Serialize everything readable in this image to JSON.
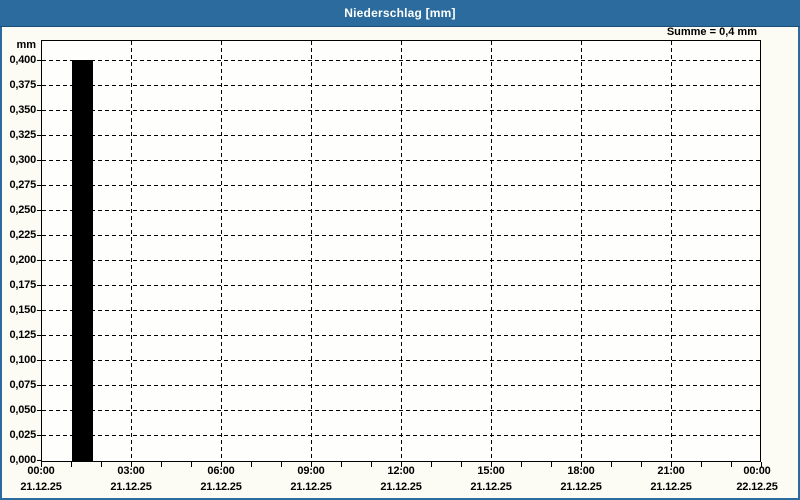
{
  "window": {
    "title": "Niederschlag [mm]",
    "title_bar_color": "#2b6b9d",
    "border_color": "#2b6b9d"
  },
  "summary": {
    "text": "Summe = 0,4 mm"
  },
  "chart_data": {
    "type": "bar",
    "title": "Niederschlag [mm]",
    "unit_label": "mm",
    "ylabel": "mm",
    "ylim": [
      0,
      0.42
    ],
    "ytick_step": 0.025,
    "ytick_labels": [
      "0,400",
      "0,375",
      "0,350",
      "0,325",
      "0,300",
      "0,275",
      "0,250",
      "0,225",
      "0,200",
      "0,175",
      "0,150",
      "0,125",
      "0,100",
      "0,075",
      "0,050",
      "0,025",
      "0,000"
    ],
    "xlim_hours": [
      0,
      24
    ],
    "x_major_every_hours": 3,
    "x_minor_every_hours": 1,
    "xticks": [
      {
        "hour": 0,
        "time": "00:00",
        "date": "21.12.25"
      },
      {
        "hour": 3,
        "time": "03:00",
        "date": "21.12.25"
      },
      {
        "hour": 6,
        "time": "06:00",
        "date": "21.12.25"
      },
      {
        "hour": 9,
        "time": "09:00",
        "date": "21.12.25"
      },
      {
        "hour": 12,
        "time": "12:00",
        "date": "21.12.25"
      },
      {
        "hour": 15,
        "time": "15:00",
        "date": "21.12.25"
      },
      {
        "hour": 18,
        "time": "18:00",
        "date": "21.12.25"
      },
      {
        "hour": 21,
        "time": "21:00",
        "date": "21.12.25"
      },
      {
        "hour": 24,
        "time": "00:00",
        "date": "22.12.25"
      }
    ],
    "grid": "dashed",
    "legend": "none",
    "bar_color": "#000000",
    "sum_value_mm": 0.4,
    "bars": [
      {
        "from_hour": 1.03,
        "to_hour": 1.73,
        "value": 0.4
      }
    ]
  }
}
